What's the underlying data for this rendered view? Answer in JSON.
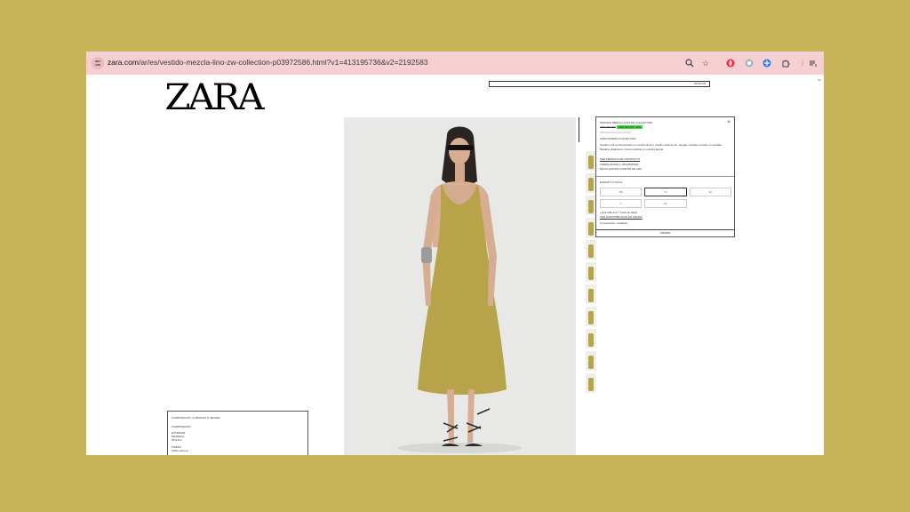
{
  "browser": {
    "url_domain": "zara.com",
    "url_path": "/ar/es/vestido-mezcla-lino-zw-collection-p03972586.html?v1=413195736&v2=2192583",
    "icons": [
      "site-settings-icon",
      "zoom-icon",
      "star-icon",
      "opera-icon",
      "extension-icon",
      "translate-icon",
      "puzzle-icon",
      "menu-icon"
    ]
  },
  "header": {
    "logo": "ZARA",
    "search_label": "BUSCAR",
    "edge_label": "INI"
  },
  "product": {
    "title": "VESTIDO MEZCLA LINO ZW COLLECTION",
    "price_old": "ARS 000.000",
    "price_badge": "ARS 000.000  -30%",
    "price_note": "IMPUESTOS INCLUIDOS",
    "collection": "ZARA WOMAN COLLECTION",
    "description_1": "Vestido midi confeccionado en mezcla de lino. Cuello redondo sin mangas. Detalle cruzado en espalda.",
    "description_2": "Bolsillos delanteros. Cierre invisible en costura lateral.",
    "color_link": "VER MEDIDAS DEL PRODUCTO",
    "ref_line": "VERDE MUSGO | 3972/586/500",
    "delivery_line": "ENVÍO GRATIS A PARTIR DE ARS",
    "size_heading": "ELEGIR TU TALLA",
    "sizes": [
      {
        "label": "XS",
        "selected": false
      },
      {
        "label": "S",
        "selected": true
      },
      {
        "label": "M",
        "selected": false
      },
      {
        "label": "L",
        "selected": false
      },
      {
        "label": "XL",
        "selected": false
      }
    ],
    "size_note_1": "¿Qué talla soy? | Guía de tallas",
    "size_note_2": "VER DISPONIBILIDAD EN TIENDA",
    "size_note_3": "Composición, cuidados",
    "add_button": "AÑADIR"
  },
  "composition": {
    "heading": "COMPOSICIÓN, CUIDADOS & ORIGEN",
    "sub": "COMPOSICIÓN",
    "line1": "EXTERIOR",
    "line2": "MATERIAL",
    "line3": "55% lino",
    "line4": "FORRO",
    "line5": "100% viscosa"
  },
  "colors": {
    "background": "#c8b55a",
    "toolbar": "#f5cfd2",
    "dress": "#b7a34a",
    "badge": "#39e03a"
  }
}
